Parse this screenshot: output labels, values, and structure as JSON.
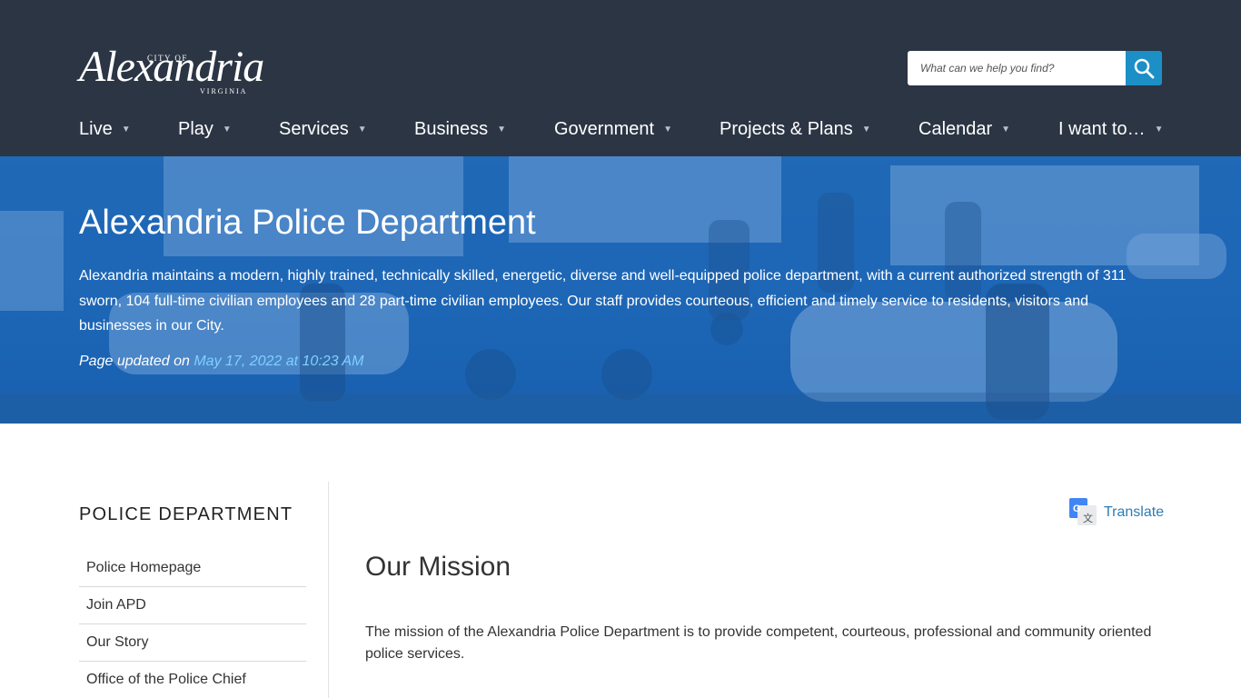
{
  "header": {
    "logo": {
      "city_of": "CITY OF",
      "name": "Alexandria",
      "state": "VIRGINIA"
    },
    "search": {
      "placeholder": "What can we help you find?",
      "icon": "search-icon"
    },
    "nav": [
      {
        "label": "Live"
      },
      {
        "label": "Play"
      },
      {
        "label": "Services"
      },
      {
        "label": "Business"
      },
      {
        "label": "Government"
      },
      {
        "label": "Projects & Plans"
      },
      {
        "label": "Calendar"
      },
      {
        "label": "I want to…"
      }
    ],
    "nav_caret": "▼"
  },
  "hero": {
    "title": "Alexandria Police Department",
    "description": "Alexandria maintains a modern, highly trained, technically skilled, energetic, diverse and well-equipped police department, with a current authorized strength of 311 sworn, 104 full-time civilian employees and 28 part-time civilian employees. Our staff provides courteous, efficient and timely service to residents, visitors and businesses in our City.",
    "updated_prefix": "Page updated on ",
    "updated_date": "May 17, 2022 at 10:23 AM"
  },
  "sidebar": {
    "title": "POLICE DEPARTMENT",
    "items": [
      {
        "label": "Police Homepage"
      },
      {
        "label": "Join APD"
      },
      {
        "label": "Our Story"
      },
      {
        "label": "Office of the Police Chief"
      }
    ]
  },
  "main": {
    "translate_label": "Translate",
    "heading": "Our Mission",
    "body": "The mission of the Alexandria Police Department is to provide competent, courteous, professional and community oriented police services."
  },
  "colors": {
    "header_bg": "#2b3544",
    "search_button": "#1b8fc6",
    "hero_blue": "#2a69ad",
    "link": "#2f7cb4",
    "date_link": "#7fd0ff"
  }
}
